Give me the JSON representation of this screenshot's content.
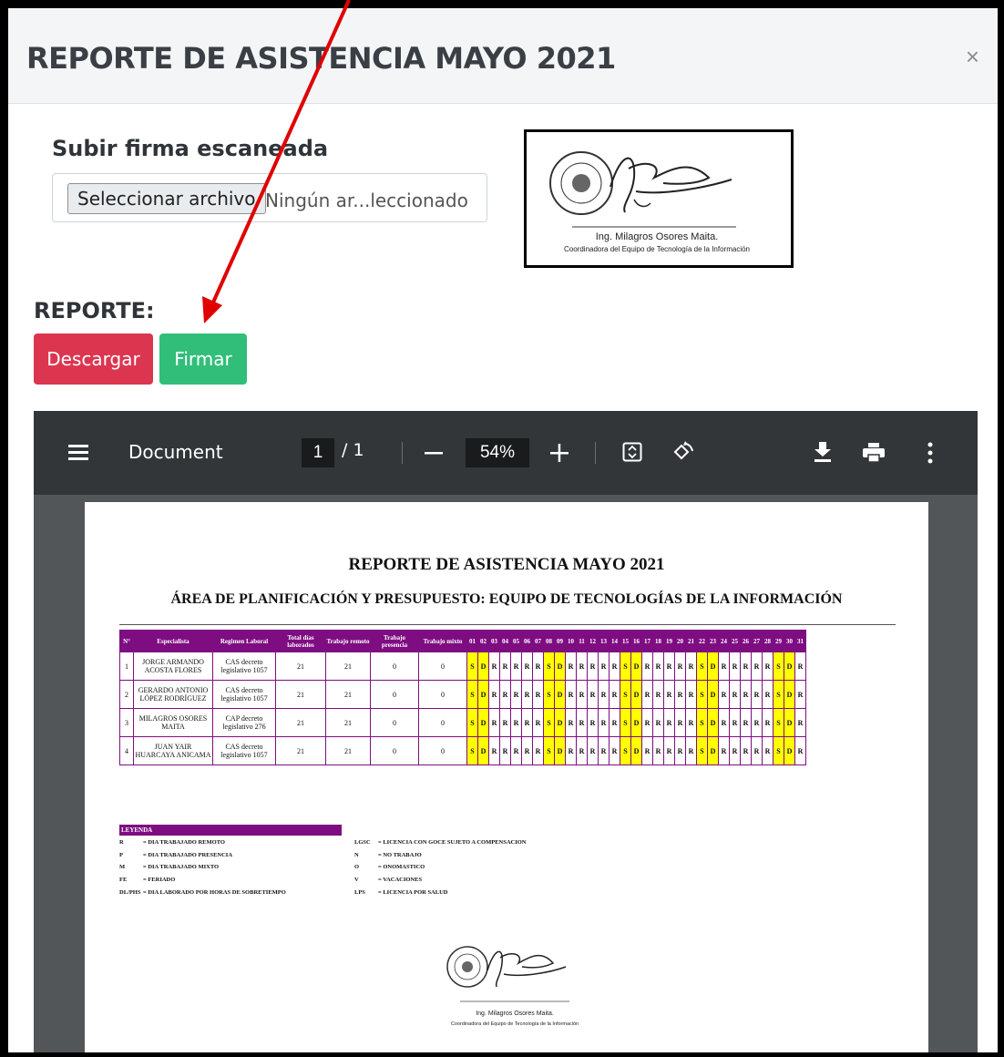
{
  "modal": {
    "title": "REPORTE DE ASISTENCIA MAYO 2021",
    "close": "×"
  },
  "upload": {
    "title": "Subir firma escaneada",
    "button": "Seleccionar archivo",
    "file_status": "Ningún ar...leccionado"
  },
  "signature": {
    "name": "Ing. Milagros Osores Maita.",
    "role": "Coordinadora del Equipo de Tecnología de la Información"
  },
  "report": {
    "label": "REPORTE:",
    "download": "Descargar",
    "sign": "Firmar"
  },
  "viewer": {
    "doc_name": "Document",
    "page_current": "1",
    "page_total": "/ 1",
    "zoom": "54%",
    "icons": [
      "menu-icon",
      "fit-page-icon",
      "rotate-icon",
      "download-icon",
      "print-icon",
      "more-icon"
    ]
  },
  "doc": {
    "title": "REPORTE DE ASISTENCIA MAYO 2021",
    "subtitle": "ÁREA DE PLANIFICACIÓN Y PRESUPUESTO: EQUIPO DE TECNOLOGÍAS DE LA INFORMACIÓN",
    "headers": [
      "N°",
      "Especialista",
      "Regimen Laboral",
      "Total días laborados",
      "Trabajo remoto",
      "Trabajo presencia",
      "Trabajo mixto"
    ],
    "days": [
      "01",
      "02",
      "03",
      "04",
      "05",
      "06",
      "07",
      "08",
      "09",
      "10",
      "11",
      "12",
      "13",
      "14",
      "15",
      "16",
      "17",
      "18",
      "19",
      "20",
      "21",
      "22",
      "23",
      "24",
      "25",
      "26",
      "27",
      "28",
      "29",
      "30",
      "31"
    ],
    "day_codes": [
      "S",
      "D",
      "R",
      "R",
      "R",
      "R",
      "R",
      "S",
      "D",
      "R",
      "R",
      "R",
      "R",
      "R",
      "S",
      "D",
      "R",
      "R",
      "R",
      "R",
      "R",
      "S",
      "D",
      "R",
      "R",
      "R",
      "R",
      "R",
      "S",
      "D",
      "R"
    ],
    "rows": [
      {
        "n": "1",
        "name": "JORGE ARMANDO ACOSTA FLORES",
        "regimen": "CAS decreto legislativo 1057",
        "total": "21",
        "remoto": "21",
        "presencia": "0",
        "mixto": "0"
      },
      {
        "n": "2",
        "name": "GERARDO ANTONIO LÓPEZ RODRÍGUEZ",
        "regimen": "CAS decreto legislativo 1057",
        "total": "21",
        "remoto": "21",
        "presencia": "0",
        "mixto": "0"
      },
      {
        "n": "3",
        "name": "MILAGROS OSORES MAITA",
        "regimen": "CAP decreto legislativo 276",
        "total": "21",
        "remoto": "21",
        "presencia": "0",
        "mixto": "0"
      },
      {
        "n": "4",
        "name": "JUAN YAIR HUARCAYA ANICAMA",
        "regimen": "CAS decreto legislativo 1057",
        "total": "21",
        "remoto": "21",
        "presencia": "0",
        "mixto": "0"
      }
    ],
    "legend_title": "LEYENDA",
    "legend_left": [
      {
        "code": "R",
        "text": "= DIA TRABAJADO REMOTO"
      },
      {
        "code": "P",
        "text": "= DIA TRABAJADO PRESENCIA"
      },
      {
        "code": "M",
        "text": "= DIA TRABAJADO MIXTO"
      },
      {
        "code": "FE",
        "text": "= FERIADO"
      },
      {
        "code": "DL/PHS",
        "text": "= DIA LABORADO POR HORAS DE SOBRETIEMPO"
      }
    ],
    "legend_right": [
      {
        "code": "LGSC",
        "text": "= LICENCIA CON GOCE SUJETO A COMPENSACION"
      },
      {
        "code": "N",
        "text": "= NO TRABAJO"
      },
      {
        "code": "O",
        "text": "= ONOMASTICO"
      },
      {
        "code": "V",
        "text": "= VACACIONES"
      },
      {
        "code": "LPS",
        "text": "= LICENCIA POR SALUD"
      }
    ]
  },
  "colors": {
    "danger": "#dc3550",
    "success": "#31be79",
    "purple": "#7e0d81",
    "highlight": "#ffff00",
    "arrow": "#e00000"
  }
}
